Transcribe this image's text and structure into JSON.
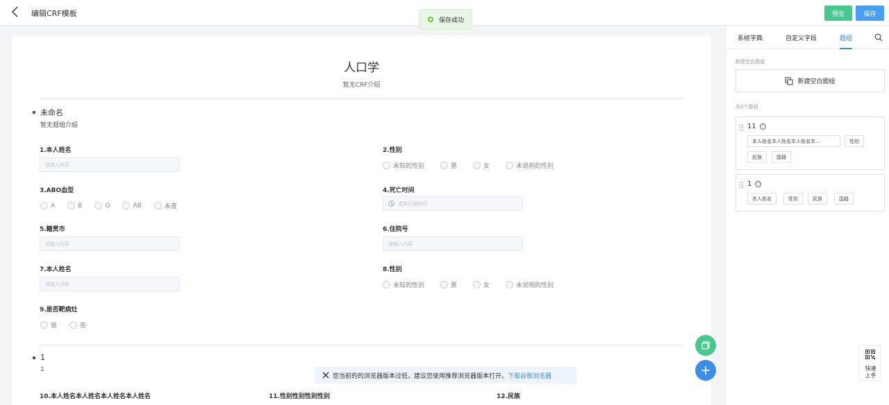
{
  "header": {
    "title": "编辑CRF模板",
    "toast": "保存成功",
    "preview_label": "预览",
    "save_label": "保存"
  },
  "form": {
    "title": "人口学",
    "intro": "暂无CRF介绍",
    "groups": [
      {
        "name": "未命名",
        "intro": "暂无题组介绍"
      },
      {
        "name": "1",
        "intro": "1"
      }
    ],
    "questions": {
      "q1": {
        "label": "1.本人姓名",
        "placeholder": "请输入内容"
      },
      "q2": {
        "label": "2.性别",
        "options": [
          "未知的性别",
          "男",
          "女",
          "未说明的性别"
        ]
      },
      "q3": {
        "label": "3.ABO血型",
        "options": [
          "A",
          "B",
          "O",
          "AB",
          "未查"
        ]
      },
      "q4": {
        "label": "4.死亡时间",
        "placeholder": "选择日期时间"
      },
      "q5": {
        "label": "5.籍贯市",
        "placeholder": "请输入内容"
      },
      "q6": {
        "label": "6.住院号",
        "placeholder": "请输入内容"
      },
      "q7": {
        "label": "7.本人姓名",
        "placeholder": "请输入内容"
      },
      "q8": {
        "label": "8.性别",
        "options": [
          "未知的性别",
          "男",
          "女",
          "未说明的性别"
        ]
      },
      "q9": {
        "label": "9.是否靶病灶",
        "options": [
          "是",
          "否"
        ]
      },
      "q10": {
        "label": "10.本人姓名本人姓名本人姓名本人姓名"
      },
      "q11": {
        "label": "11.性别性别性别性别"
      },
      "q12": {
        "label": "12.民族"
      }
    }
  },
  "panel": {
    "tabs": [
      "系统字典",
      "自定义字段",
      "题组"
    ],
    "new_caption": "新建空白题组",
    "new_button": "新建空白题组",
    "count_caption": "共2个题组",
    "groups": [
      {
        "name": "11",
        "chips": [
          "本人姓名本人姓名本人姓名本...",
          "性别",
          "民族",
          "国籍"
        ]
      },
      {
        "name": "1",
        "chips": [
          "本人姓名",
          "性别",
          "民族",
          "国籍"
        ]
      }
    ]
  },
  "quick": {
    "line1": "快速",
    "line2": "上手"
  },
  "banner": {
    "text": "您当前的的浏览器版本过低，建议您使用推荐浏览器版本打开。",
    "link": "下载谷歌浏览器"
  },
  "colors": {
    "primary": "#3a8ee6",
    "success": "#47c98e",
    "save": "#45a0f5"
  }
}
